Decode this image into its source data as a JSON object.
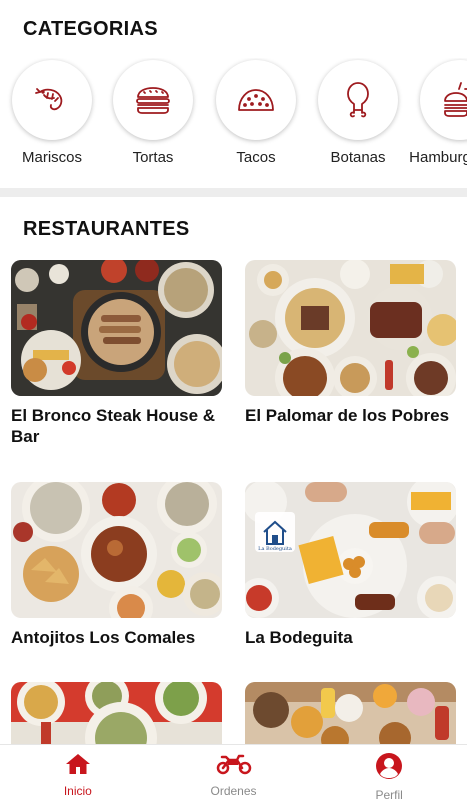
{
  "categories": {
    "title": "CATEGORIAS",
    "items": [
      {
        "label": "Mariscos",
        "icon": "shrimp-icon"
      },
      {
        "label": "Tortas",
        "icon": "burger-icon"
      },
      {
        "label": "Tacos",
        "icon": "taco-icon"
      },
      {
        "label": "Botanas",
        "icon": "drumstick-icon"
      },
      {
        "label": "Hamburguesas",
        "icon": "fastfood-icon"
      }
    ]
  },
  "restaurants": {
    "title": "RESTAURANTES",
    "items": [
      {
        "name": "El Bronco Steak House & Bar"
      },
      {
        "name": "El Palomar de los Pobres"
      },
      {
        "name": "Antojitos Los Comales"
      },
      {
        "name": "La Bodeguita"
      },
      {
        "name": ""
      },
      {
        "name": ""
      }
    ],
    "logo_text": "La Bodeguita"
  },
  "bottom_nav": {
    "items": [
      {
        "label": "Inicio",
        "icon": "home-icon",
        "active": true
      },
      {
        "label": "Ordenes",
        "icon": "motorcycle-icon",
        "active": false
      },
      {
        "label": "Perfil",
        "icon": "user-icon",
        "active": false
      }
    ]
  },
  "colors": {
    "accent": "#c8161d",
    "icon_red": "#9e1b1f",
    "inactive": "#8a8a8a"
  }
}
